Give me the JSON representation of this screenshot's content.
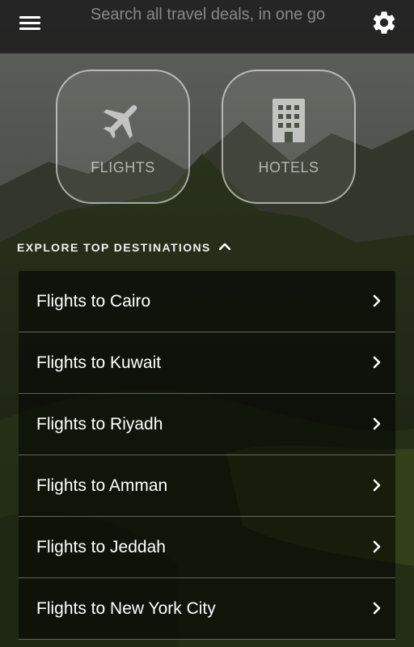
{
  "topbar": {
    "search_placeholder": "Search all travel deals, in one go",
    "menu_icon": "hamburger-menu-icon",
    "settings_icon": "gear-icon"
  },
  "categories": [
    {
      "label": "FLIGHTS",
      "icon": "airplane-icon"
    },
    {
      "label": "HOTELS",
      "icon": "building-icon"
    }
  ],
  "explore": {
    "label": "EXPLORE TOP DESTINATIONS",
    "icon": "chevron-up-icon"
  },
  "destinations": [
    {
      "label": "Flights to Cairo"
    },
    {
      "label": "Flights to Kuwait"
    },
    {
      "label": "Flights to Riyadh"
    },
    {
      "label": "Flights to Amman"
    },
    {
      "label": "Flights to Jeddah"
    },
    {
      "label": "Flights to New York City"
    }
  ],
  "colors": {
    "topbar_bg": "#141414",
    "list_bg": "#000000",
    "text": "#ffffff"
  }
}
